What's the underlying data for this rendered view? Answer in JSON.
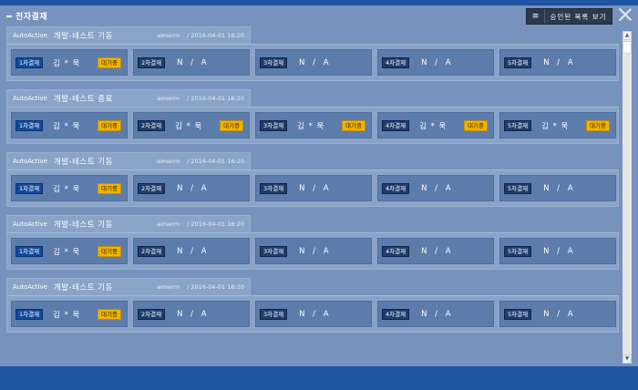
{
  "window": {
    "title": "전자결재",
    "approved_list_label": "승인된 목록 보기",
    "menu_icon": "≡",
    "close_icon": "close-icon"
  },
  "colors": {
    "accent": "#1f55a3",
    "background": "#7692bd",
    "waiting_badge": "#f0b400",
    "step_label": "#1f3c6b"
  },
  "groups": [
    {
      "prefix": "AutoActive",
      "title": "개발-테스트 기동",
      "user": "aimerm",
      "date": "/ 2016-04-01 16:20",
      "steps": [
        {
          "label": "1차결재",
          "name": "김 * 욱",
          "badge": "대기중"
        },
        {
          "label": "2차결재",
          "name": "N / A",
          "badge": ""
        },
        {
          "label": "3차결재",
          "name": "N / A",
          "badge": ""
        },
        {
          "label": "4차결재",
          "name": "N / A",
          "badge": ""
        },
        {
          "label": "5차결재",
          "name": "N / A",
          "badge": ""
        }
      ]
    },
    {
      "prefix": "AutoActive",
      "title": "개발-테스트 종료",
      "user": "aimerm",
      "date": "/ 2016-04-01 16:20",
      "steps": [
        {
          "label": "1차결재",
          "name": "김 * 욱",
          "badge": "대기중"
        },
        {
          "label": "2차결재",
          "name": "김 * 욱",
          "badge": "대기중"
        },
        {
          "label": "3차결재",
          "name": "김 * 욱",
          "badge": "대기중"
        },
        {
          "label": "4차결재",
          "name": "김 * 욱",
          "badge": "대기중"
        },
        {
          "label": "5차결재",
          "name": "김 * 욱",
          "badge": "대기중"
        }
      ]
    },
    {
      "prefix": "AutoActive",
      "title": "개발-테스트 기동",
      "user": "aimerm",
      "date": "/ 2016-04-01 16:20",
      "steps": [
        {
          "label": "1차결재",
          "name": "김 * 욱",
          "badge": "대기중"
        },
        {
          "label": "2차결재",
          "name": "N / A",
          "badge": ""
        },
        {
          "label": "3차결재",
          "name": "N / A",
          "badge": ""
        },
        {
          "label": "4차결재",
          "name": "N / A",
          "badge": ""
        },
        {
          "label": "5차결재",
          "name": "N / A",
          "badge": ""
        }
      ]
    },
    {
      "prefix": "AutoActive",
      "title": "개발-테스트 기동",
      "user": "aimerm",
      "date": "/ 2016-04-01 16:20",
      "steps": [
        {
          "label": "1차결재",
          "name": "김 * 욱",
          "badge": "대기중"
        },
        {
          "label": "2차결재",
          "name": "N / A",
          "badge": ""
        },
        {
          "label": "3차결재",
          "name": "N / A",
          "badge": ""
        },
        {
          "label": "4차결재",
          "name": "N / A",
          "badge": ""
        },
        {
          "label": "5차결재",
          "name": "N / A",
          "badge": ""
        }
      ]
    },
    {
      "prefix": "AutoActive",
      "title": "개발-테스트 기동",
      "user": "aimerm",
      "date": "/ 2016-04-01 16:20",
      "steps": [
        {
          "label": "1차결재",
          "name": "김 * 욱",
          "badge": "대기중"
        },
        {
          "label": "2차결재",
          "name": "N / A",
          "badge": ""
        },
        {
          "label": "3차결재",
          "name": "N / A",
          "badge": ""
        },
        {
          "label": "4차결재",
          "name": "N / A",
          "badge": ""
        },
        {
          "label": "5차결재",
          "name": "N / A",
          "badge": ""
        }
      ]
    }
  ]
}
